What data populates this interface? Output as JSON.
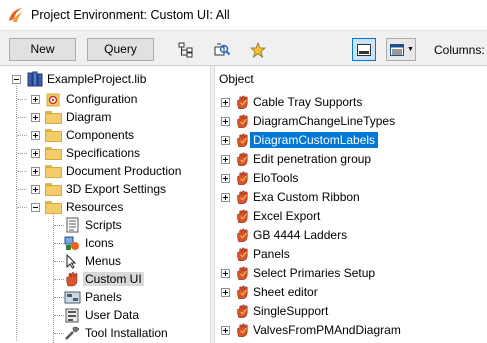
{
  "window": {
    "title": "Project Environment: Custom UI: All"
  },
  "toolbar": {
    "new_label": "New",
    "query_label": "Query",
    "columns_label": "Columns:"
  },
  "tree": {
    "root": "ExampleProject.lib",
    "top_items": [
      "Configuration",
      "Diagram",
      "Components",
      "Specifications",
      "Document Production",
      "3D Export Settings",
      "Resources"
    ],
    "resource_items": [
      "Scripts",
      "Icons",
      "Menus",
      "Custom UI",
      "Panels",
      "User Data",
      "Tool Installation"
    ],
    "selected": "Custom UI"
  },
  "list": {
    "column_header": "Object",
    "items": [
      {
        "label": "Cable Tray Supports",
        "expandable": true,
        "selected": false
      },
      {
        "label": "DiagramChangeLineTypes",
        "expandable": true,
        "selected": false
      },
      {
        "label": "DiagramCustomLabels",
        "expandable": true,
        "selected": true
      },
      {
        "label": "Edit penetration group",
        "expandable": true,
        "selected": false
      },
      {
        "label": "EloTools",
        "expandable": true,
        "selected": false
      },
      {
        "label": "Exa Custom Ribbon",
        "expandable": true,
        "selected": false
      },
      {
        "label": "Excel Export",
        "expandable": false,
        "selected": false
      },
      {
        "label": "GB 4444 Ladders",
        "expandable": false,
        "selected": false
      },
      {
        "label": "Panels",
        "expandable": false,
        "selected": false
      },
      {
        "label": "Select Primaries Setup",
        "expandable": true,
        "selected": false
      },
      {
        "label": "Sheet editor",
        "expandable": true,
        "selected": false
      },
      {
        "label": "SingleSupport",
        "expandable": false,
        "selected": false
      },
      {
        "label": "ValvesFromPMAndDiagram",
        "expandable": true,
        "selected": false
      }
    ]
  },
  "colors": {
    "selection": "#0078d7",
    "folder": "#f3cd6a",
    "hand_icon": "#d8532f",
    "toolbar_bg": "#f0f0f0"
  }
}
